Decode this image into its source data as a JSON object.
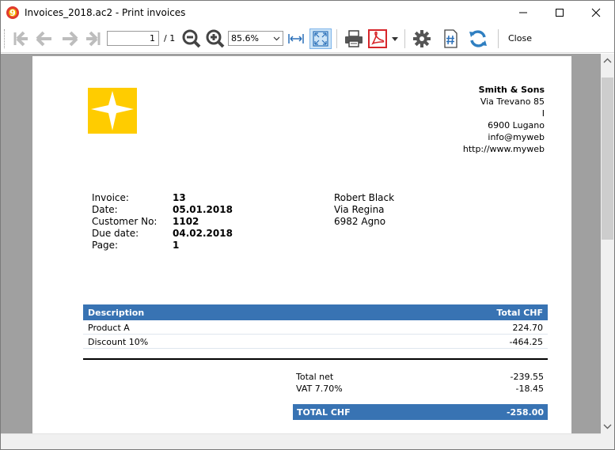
{
  "window": {
    "title": "Invoices_2018.ac2 - Print invoices"
  },
  "toolbar": {
    "page_value": "1",
    "page_total": "/ 1",
    "zoom_value": "85.6%",
    "close_label": "Close"
  },
  "colors": {
    "accent": "#3873b3",
    "logo": "#ffcc00",
    "preview_bg": "#a0a0a0",
    "pdf_red": "#d7262b",
    "refresh_blue": "#2f7fc1"
  },
  "invoice": {
    "company": {
      "name": "Smith & Sons",
      "street": "Via Trevano 85",
      "country": "I",
      "city": "6900 Lugano",
      "email": "info@myweb",
      "web": "http://www.myweb"
    },
    "labels": {
      "invoice": "Invoice:",
      "date": "Date:",
      "customer_no": "Customer No:",
      "due_date": "Due date:",
      "page": "Page:"
    },
    "values": {
      "invoice": "13",
      "date": "05.01.2018",
      "customer_no": "1102",
      "due_date": "04.02.2018",
      "page": "1"
    },
    "address": {
      "name": "Robert Black",
      "street": "Via Regina",
      "city": "6982 Agno"
    },
    "table": {
      "header_desc": "Description",
      "header_total": "Total CHF",
      "rows": [
        {
          "desc": "Product A",
          "total": "224.70"
        },
        {
          "desc": "Discount 10%",
          "total": "-464.25"
        }
      ]
    },
    "totals": {
      "net_label": "Total net",
      "net_value": "-239.55",
      "vat_label": "VAT 7.70%",
      "vat_value": "-18.45",
      "grand_label": "TOTAL CHF",
      "grand_value": "-258.00"
    }
  }
}
